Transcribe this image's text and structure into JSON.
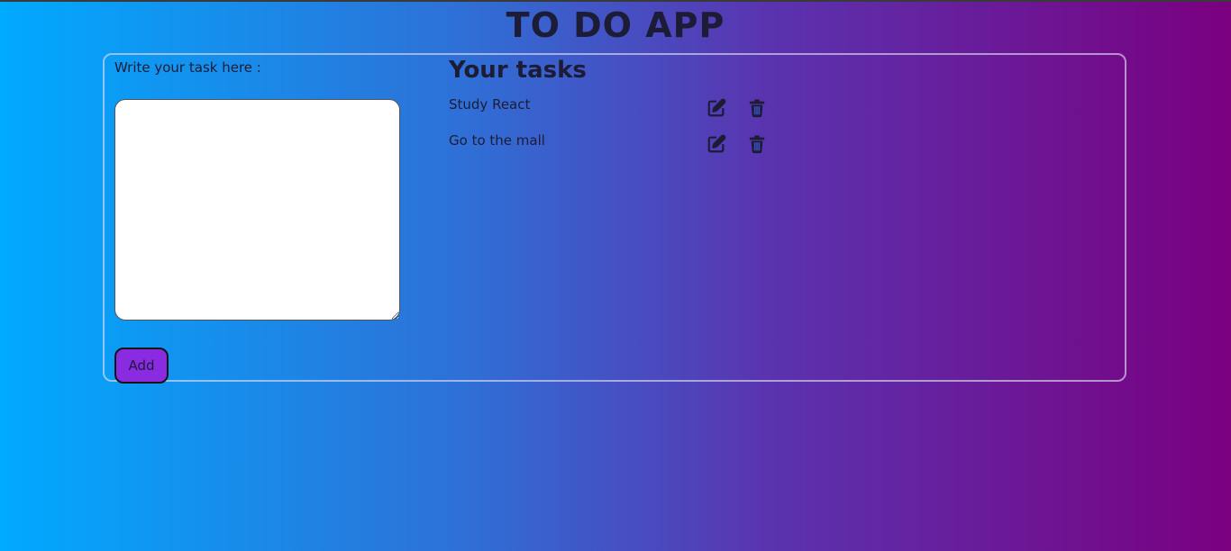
{
  "header": {
    "title": "TO DO APP"
  },
  "form": {
    "label": "Write your task here :",
    "textarea_value": "",
    "add_label": "Add"
  },
  "tasks": {
    "heading": "Your tasks",
    "items": [
      {
        "text": "Study React",
        "edit_icon": "edit-icon",
        "delete_icon": "trash-icon"
      },
      {
        "text": "Go to the mall",
        "edit_icon": "edit-icon",
        "delete_icon": "trash-icon"
      }
    ]
  },
  "colors": {
    "gradient_start": "#00aaff",
    "gradient_end": "#7a0080",
    "add_button": "#8a2be2",
    "text": "#1c1c36"
  }
}
